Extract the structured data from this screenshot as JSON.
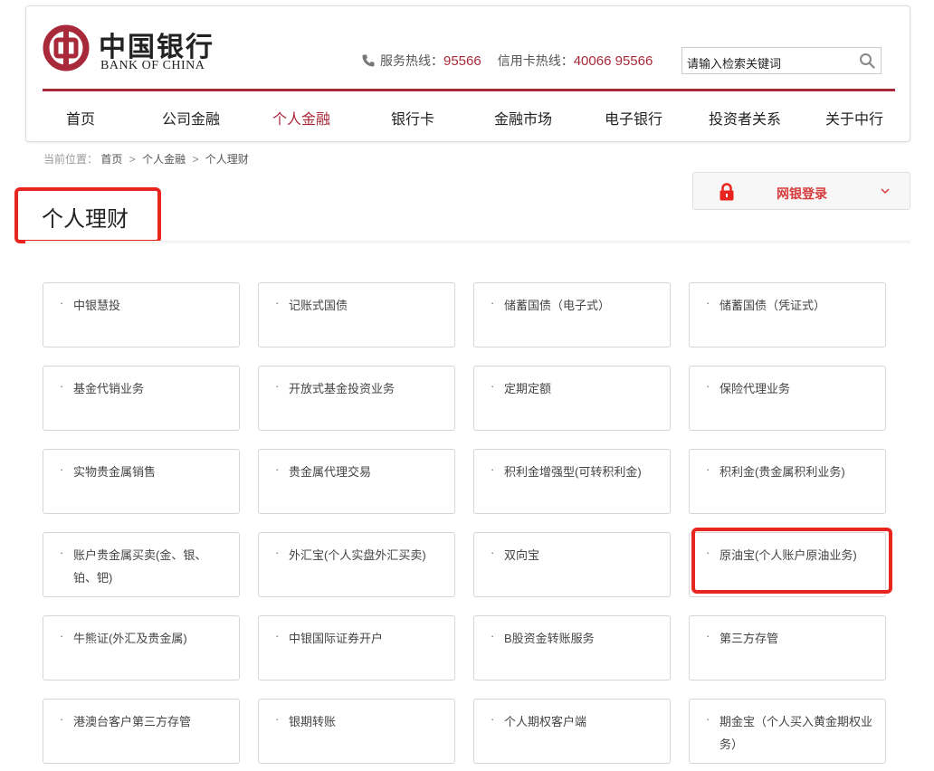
{
  "header": {
    "logo_cn": "中国银行",
    "logo_en": "BANK OF CHINA",
    "service_hotline_label": "服务热线：",
    "service_hotline_number": "95566",
    "card_hotline_label": "信用卡热线：",
    "card_hotline_number": "40066 95566",
    "search_placeholder": "请输入检索关键词",
    "nav": [
      "首页",
      "公司金融",
      "个人金融",
      "银行卡",
      "金融市场",
      "电子银行",
      "投资者关系",
      "关于中行"
    ],
    "active_nav": "个人金融"
  },
  "breadcrumb": {
    "prefix": "当前位置：",
    "items": [
      "首页",
      "个人金融",
      "个人理财"
    ],
    "separator": ">"
  },
  "login": {
    "label": "网银登录"
  },
  "page": {
    "title": "个人理财"
  },
  "cards": {
    "bullet": "·",
    "items": [
      "中银慧投",
      "记账式国债",
      "储蓄国债（电子式）",
      "储蓄国债（凭证式）",
      "基金代销业务",
      "开放式基金投资业务",
      "定期定额",
      "保险代理业务",
      "实物贵金属销售",
      "贵金属代理交易",
      "积利金增强型(可转积利金)",
      "积利金(贵金属积利业务)",
      "账户贵金属买卖(金、银、铂、钯)",
      "外汇宝(个人实盘外汇买卖)",
      "双向宝",
      "原油宝(个人账户原油业务)",
      "牛熊证(外汇及贵金属)",
      "中银国际证券开户",
      "B股资金转账服务",
      "第三方存管",
      "港澳台客户第三方存管",
      "银期转账",
      "个人期权客户端",
      "期金宝（个人买入黄金期权业务）"
    ]
  },
  "colors": {
    "brand": "#a8293a",
    "highlight": "#e8251e",
    "login_text": "#d63a3a"
  }
}
